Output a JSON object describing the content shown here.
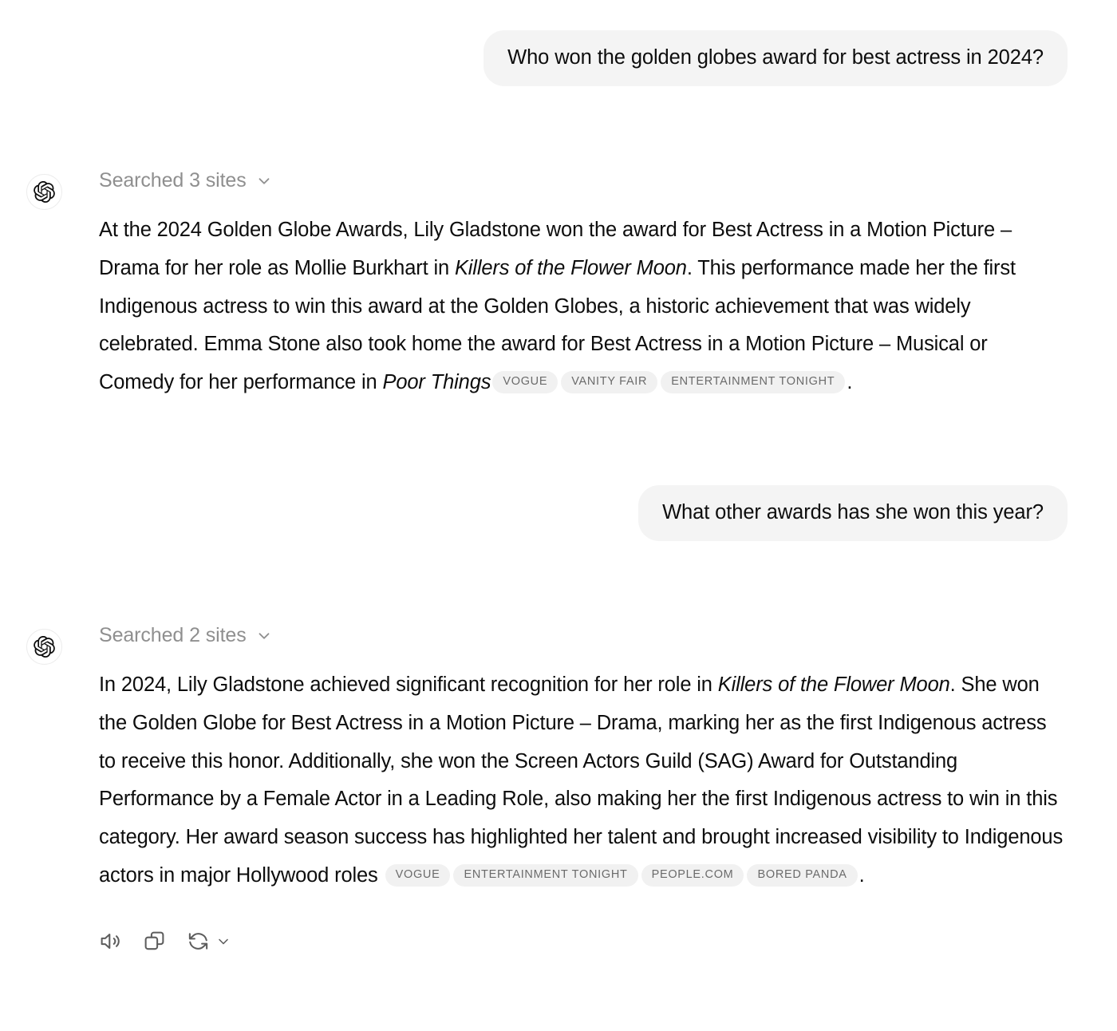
{
  "conversation": {
    "turns": [
      {
        "role": "user",
        "text": "Who won the golden globes award for best actress in 2024?"
      },
      {
        "role": "assistant",
        "search_status": "Searched 3 sites",
        "paragraph": {
          "part1": "At the 2024 Golden Globe Awards, Lily Gladstone won the award for Best Actress in a Motion Picture – Drama for her role as Mollie Burkhart in ",
          "italic1": "Killers of the Flower Moon",
          "part2": ". This performance made her the first Indigenous actress to win this award at the Golden Globes, a historic achievement that was widely celebrated. Emma Stone also took home the award for Best Actress in a Motion Picture – Musical or Comedy for her performance in ",
          "italic2": "Poor Things",
          "part3": "."
        },
        "citations": [
          "VOGUE",
          "VANITY FAIR",
          "ENTERTAINMENT TONIGHT"
        ]
      },
      {
        "role": "user",
        "text": "What other awards has she won this year?"
      },
      {
        "role": "assistant",
        "search_status": "Searched 2 sites",
        "paragraph": {
          "part1": "In 2024, Lily Gladstone achieved significant recognition for her role in ",
          "italic1": "Killers of the Flower Moon",
          "part2": ". She won the Golden Globe for Best Actress in a Motion Picture – Drama, marking her as the first Indigenous actress to receive this honor. Additionally, she won the Screen Actors Guild (SAG) Award for Outstanding Performance by a Female Actor in a Leading Role, also making her the first Indigenous actress to win in this category. Her award season success has highlighted her talent and brought increased visibility to Indigenous actors in major Hollywood roles ",
          "part3": "."
        },
        "citations": [
          "VOGUE",
          "ENTERTAINMENT TONIGHT",
          "PEOPLE.COM",
          "BORED PANDA"
        ],
        "actions": [
          {
            "name": "read-aloud",
            "label": "Read aloud"
          },
          {
            "name": "copy",
            "label": "Copy"
          },
          {
            "name": "regenerate",
            "label": "Regenerate"
          }
        ]
      }
    ]
  },
  "icons": {
    "avatar": "openai-logo-icon",
    "chevron": "chevron-down-icon",
    "speaker": "speaker-icon",
    "copy": "copy-icon",
    "regenerate": "regenerate-icon"
  },
  "colors": {
    "bubble_bg": "#f4f4f4",
    "chip_bg": "#f1f1f1",
    "chip_text": "#6b6b6b",
    "muted_text": "#8f8f8f",
    "body_text": "#0d0d0d",
    "icon": "#5d5d5d"
  }
}
